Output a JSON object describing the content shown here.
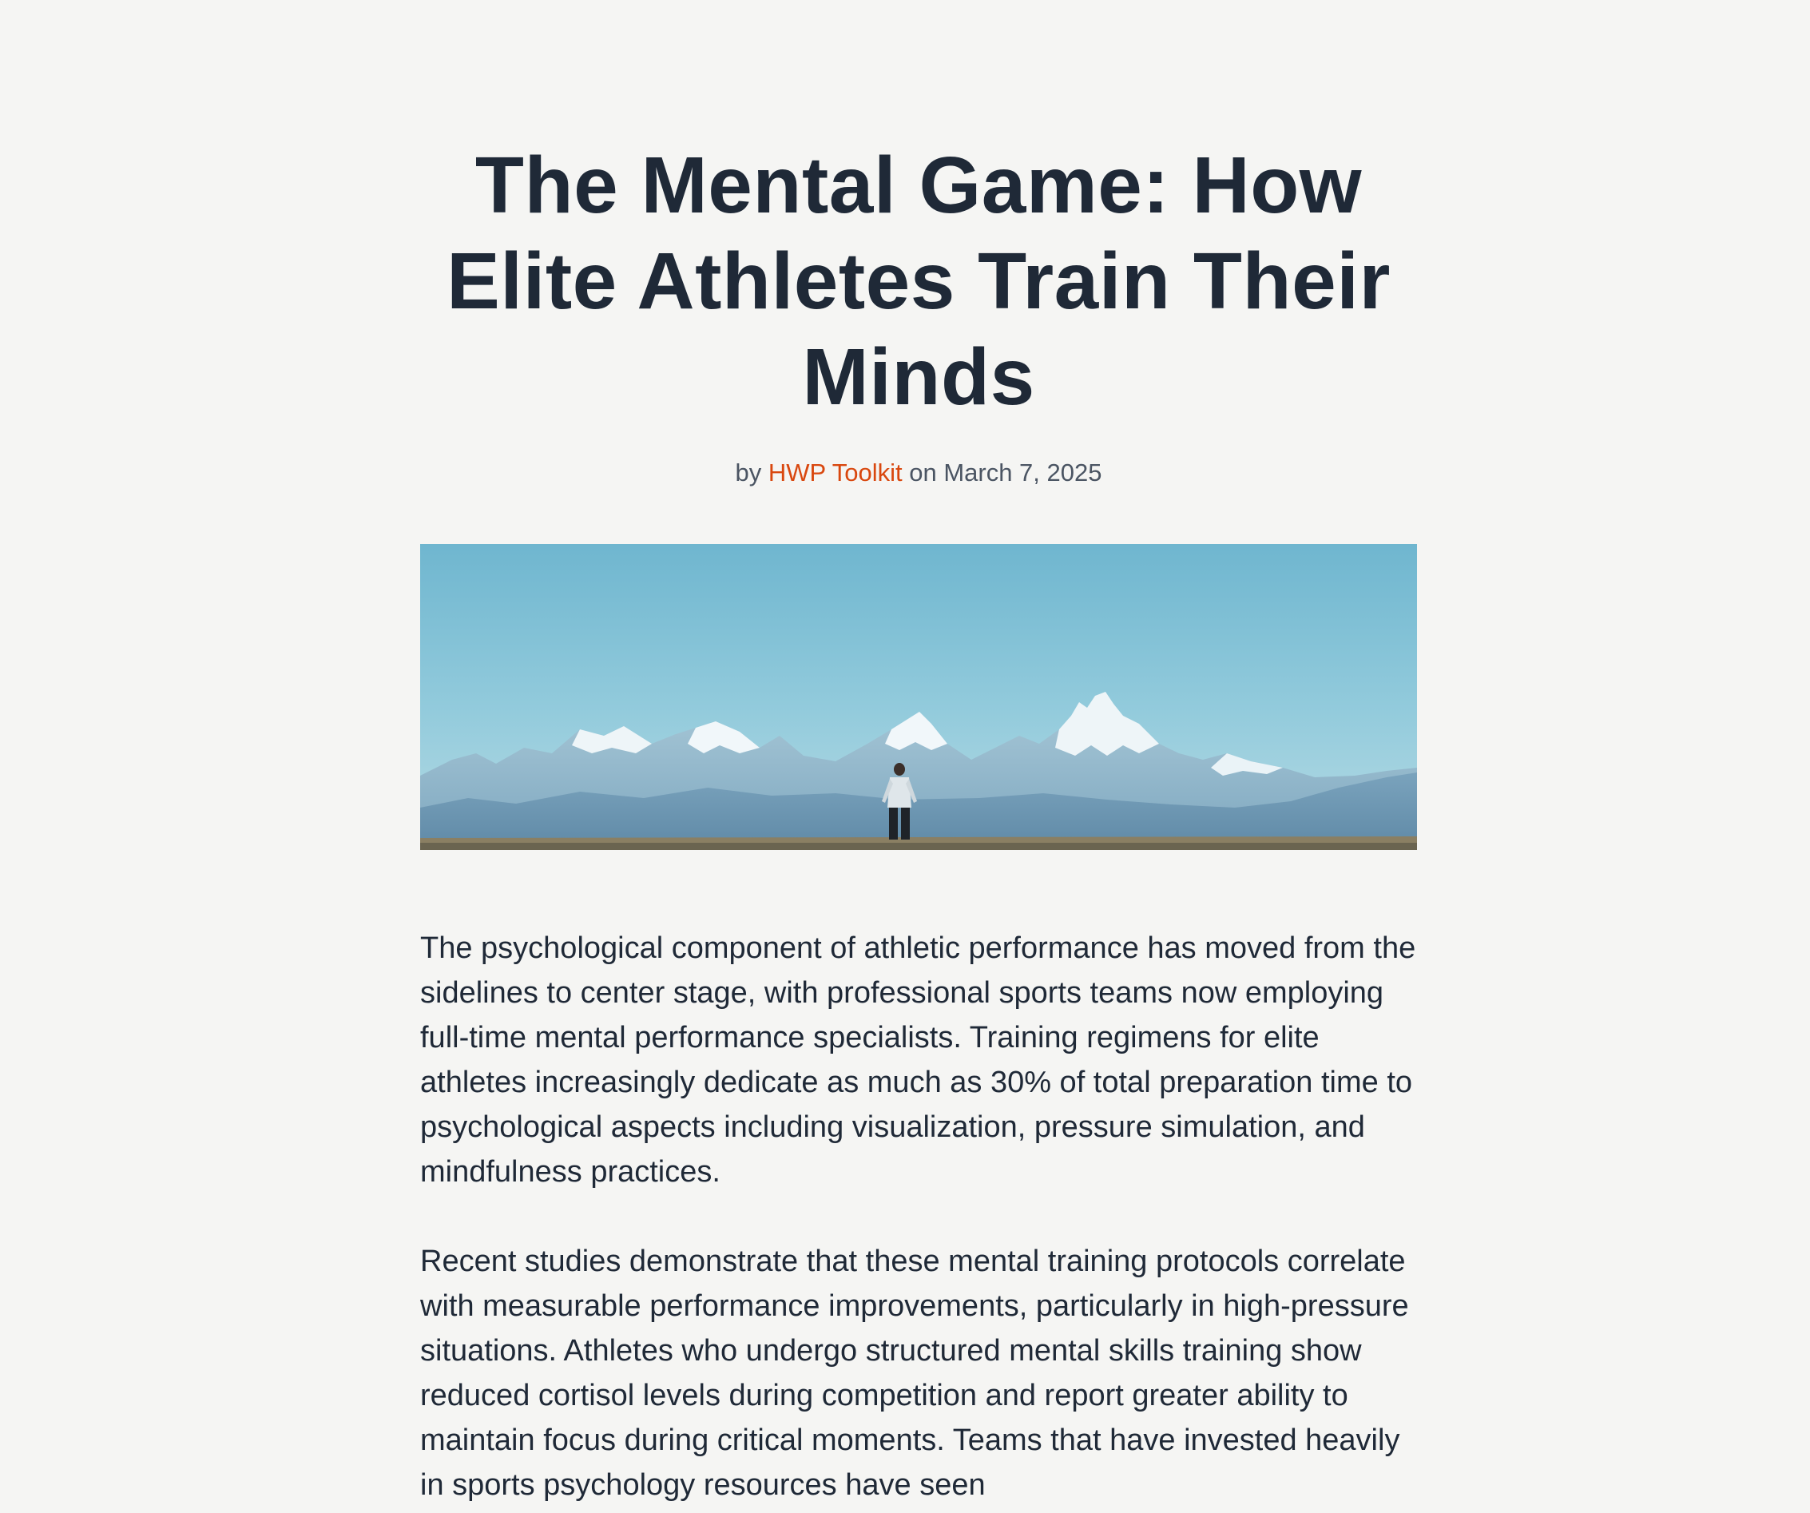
{
  "article": {
    "title": "The Mental Game: How Elite Athletes Train Their Minds",
    "byline": {
      "prefix": "by",
      "author": "HWP Toolkit",
      "date_prefix": "on",
      "date": "March 7, 2025"
    },
    "hero_image": {
      "icon": "mountain-runner-photo"
    },
    "paragraphs": [
      "The psychological component of athletic performance has moved from the sidelines to center stage, with professional sports teams now employing full-time mental performance specialists. Training regimens for elite athletes increasingly dedicate as much as 30% of total preparation time to psychological aspects including visualization, pressure simulation, and mindfulness practices.",
      "Recent studies demonstrate that these mental training protocols correlate with measurable performance improvements, particularly in high-pressure situations. Athletes who undergo structured mental skills training show reduced cortisol levels during competition and report greater ability to maintain focus during critical moments. Teams that have invested heavily in sports psychology resources have seen"
    ]
  },
  "colors": {
    "background": "#f5f5f3",
    "title": "#1f2937",
    "body_text": "#1f2937",
    "meta_text": "#4b5563",
    "author_link": "#d9480f"
  }
}
